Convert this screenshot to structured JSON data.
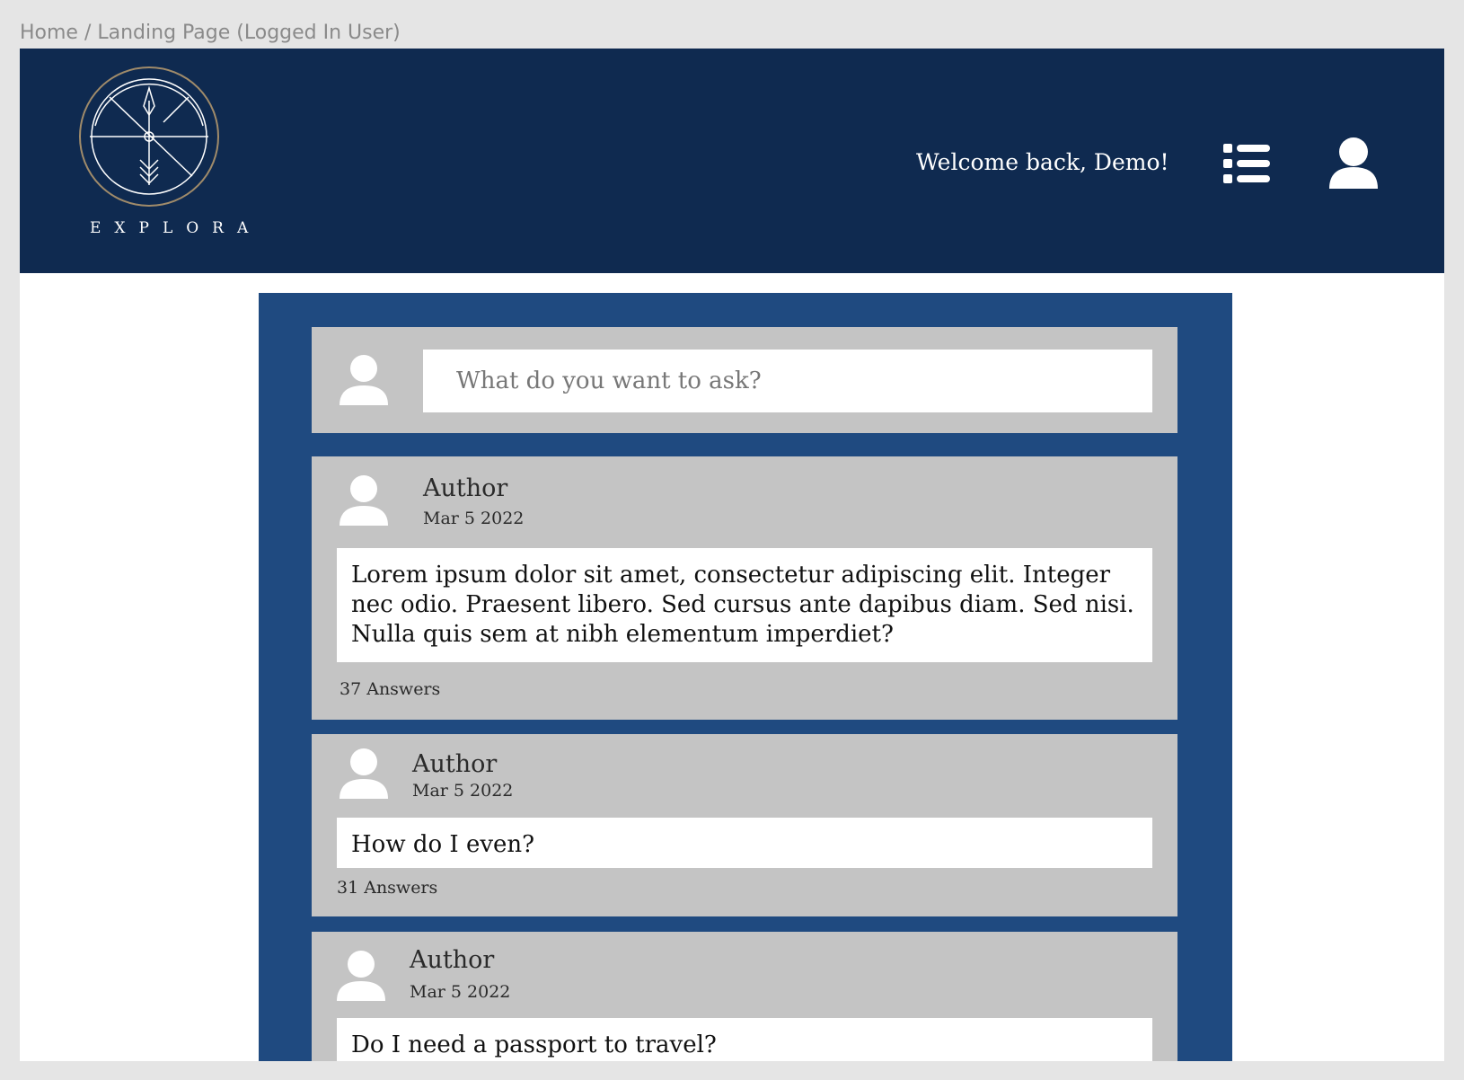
{
  "breadcrumb": "Home / Landing Page (Logged In User)",
  "header": {
    "logo_text": "EXPLORA",
    "welcome": "Welcome back, Demo!",
    "menu_icon": "list-icon",
    "profile_icon": "user-icon"
  },
  "ask": {
    "placeholder": "What do you want to ask?"
  },
  "posts": [
    {
      "author": "Author",
      "date": "Mar 5 2022",
      "question": "Lorem ipsum dolor sit amet, consectetur adipiscing elit. Integer nec odio. Praesent libero. Sed cursus ante dapibus diam. Sed nisi. Nulla quis sem at nibh elementum imperdiet?",
      "answers": "37 Answers"
    },
    {
      "author": "Author",
      "date": "Mar 5 2022",
      "question": "How do I even?",
      "answers": "31 Answers"
    },
    {
      "author": "Author",
      "date": "Mar 5 2022",
      "question": "Do I need a passport to travel?",
      "answers": ""
    }
  ],
  "colors": {
    "header_bg": "#0f2a50",
    "feed_bg": "#1f4a80",
    "card_bg": "#c4c4c4",
    "page_bg": "#e5e5e5"
  }
}
